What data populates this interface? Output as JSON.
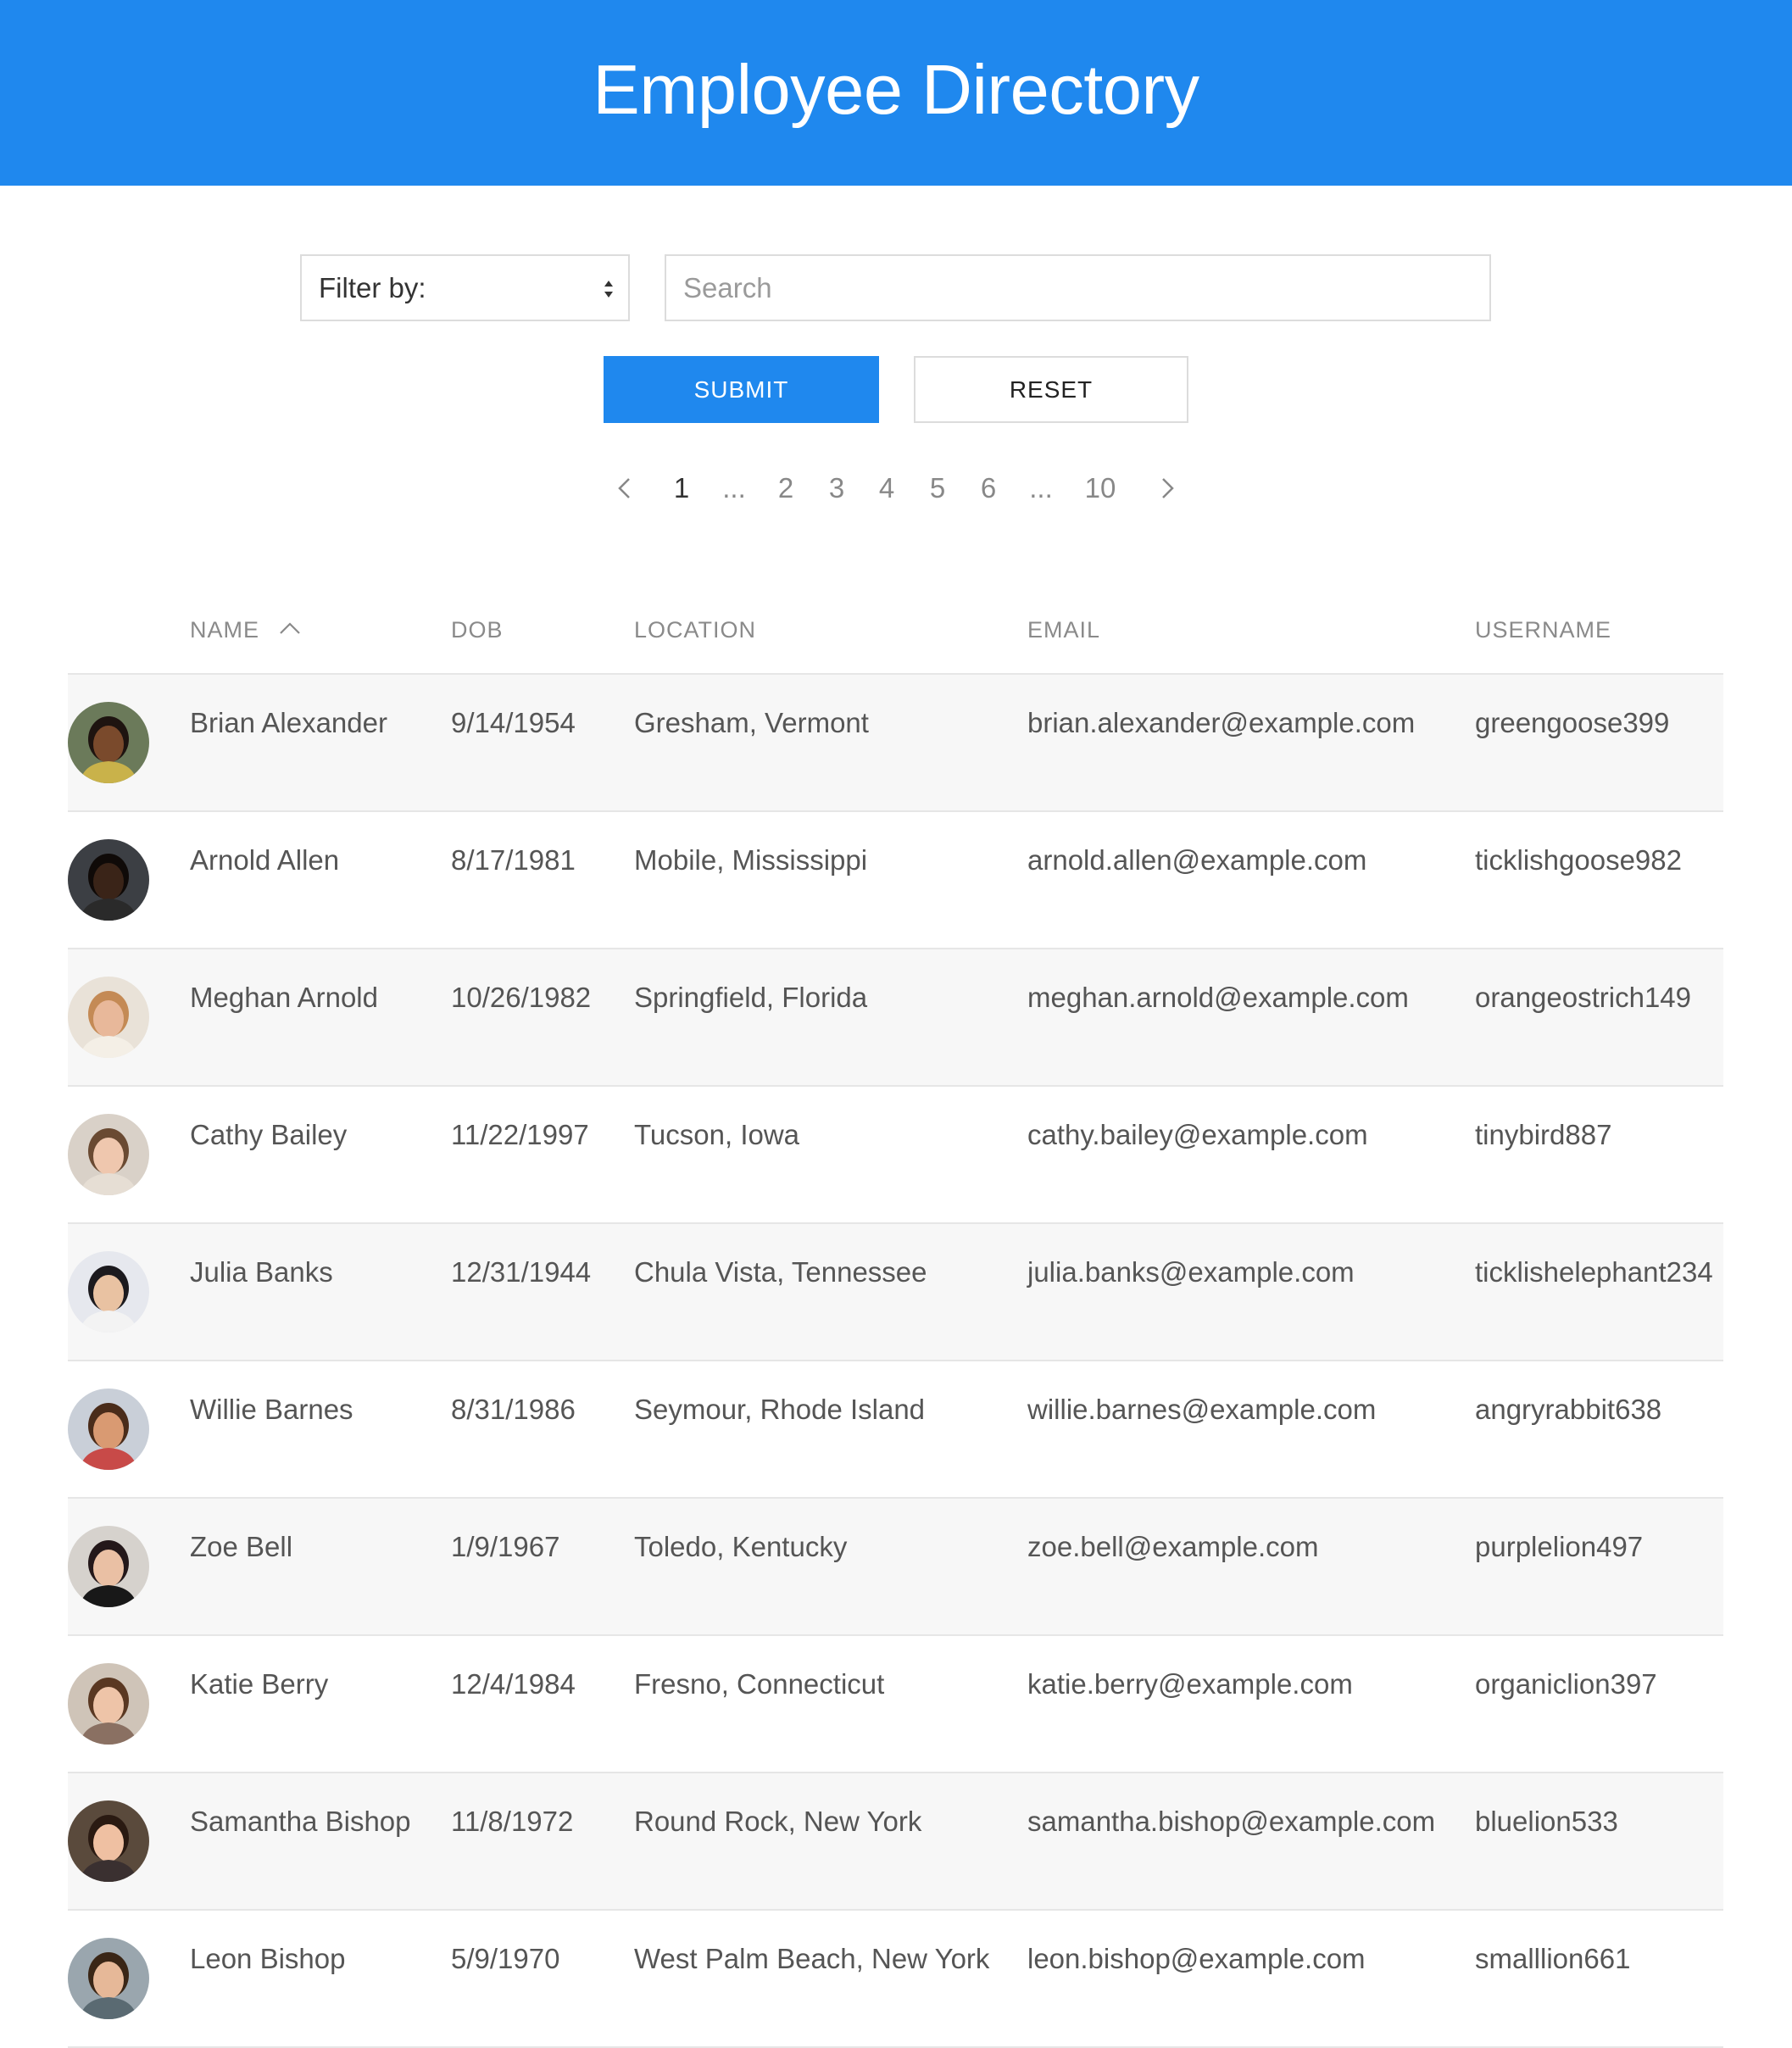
{
  "header": {
    "title": "Employee Directory"
  },
  "controls": {
    "filter_label": "Filter by:",
    "search_placeholder": "Search",
    "submit_label": "SUBMIT",
    "reset_label": "RESET"
  },
  "pagination": {
    "items": [
      "1",
      "...",
      "2",
      "3",
      "4",
      "5",
      "6",
      "...",
      "10"
    ],
    "current": "1"
  },
  "table": {
    "columns": {
      "name": "NAME",
      "dob": "DOB",
      "location": "LOCATION",
      "email": "EMAIL",
      "username": "USERNAME"
    },
    "sort": {
      "column": "name",
      "direction": "ascending"
    },
    "rows": [
      {
        "name": "Brian Alexander",
        "dob": "9/14/1954",
        "location": "Gresham, Vermont",
        "email": "brian.alexander@example.com",
        "username": "greengoose399"
      },
      {
        "name": "Arnold Allen",
        "dob": "8/17/1981",
        "location": "Mobile, Mississippi",
        "email": "arnold.allen@example.com",
        "username": "ticklishgoose982"
      },
      {
        "name": "Meghan Arnold",
        "dob": "10/26/1982",
        "location": "Springfield, Florida",
        "email": "meghan.arnold@example.com",
        "username": "orangeostrich149"
      },
      {
        "name": "Cathy Bailey",
        "dob": "11/22/1997",
        "location": "Tucson, Iowa",
        "email": "cathy.bailey@example.com",
        "username": "tinybird887"
      },
      {
        "name": "Julia Banks",
        "dob": "12/31/1944",
        "location": "Chula Vista, Tennessee",
        "email": "julia.banks@example.com",
        "username": "ticklishelephant234"
      },
      {
        "name": "Willie Barnes",
        "dob": "8/31/1986",
        "location": "Seymour, Rhode Island",
        "email": "willie.barnes@example.com",
        "username": "angryrabbit638"
      },
      {
        "name": "Zoe Bell",
        "dob": "1/9/1967",
        "location": "Toledo, Kentucky",
        "email": "zoe.bell@example.com",
        "username": "purplelion497"
      },
      {
        "name": "Katie Berry",
        "dob": "12/4/1984",
        "location": "Fresno, Connecticut",
        "email": "katie.berry@example.com",
        "username": "organiclion397"
      },
      {
        "name": "Samantha Bishop",
        "dob": "11/8/1972",
        "location": "Round Rock, New York",
        "email": "samantha.bishop@example.com",
        "username": "bluelion533"
      },
      {
        "name": "Leon Bishop",
        "dob": "5/9/1970",
        "location": "West Palm Beach, New York",
        "email": "leon.bishop@example.com",
        "username": "smalllion661"
      }
    ]
  },
  "colors": {
    "accent": "#1f88ee",
    "row_alt": "#f7f7f7",
    "divider": "#e6e6e6"
  }
}
